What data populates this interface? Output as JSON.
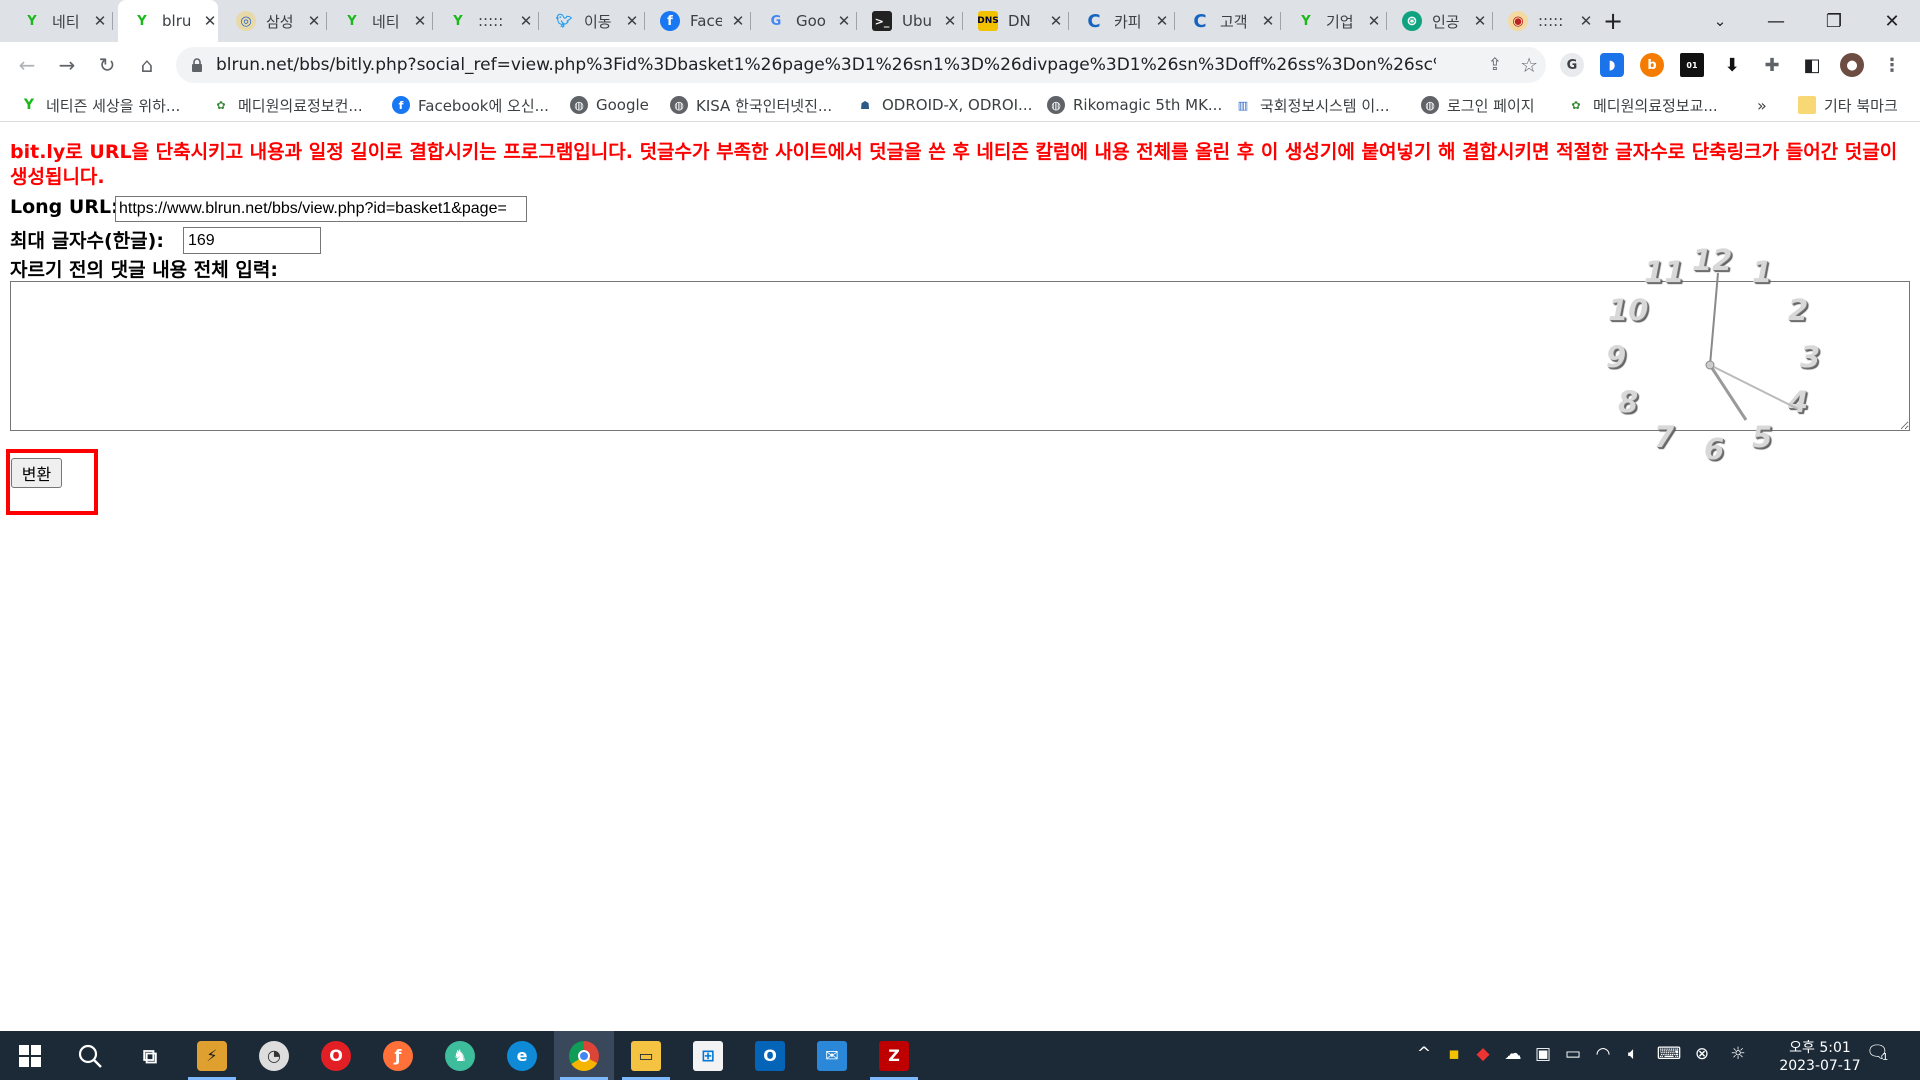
{
  "tabs": [
    {
      "label": "네티",
      "icon": "naver-sprout-icon"
    },
    {
      "label": "blru",
      "icon": "naver-sprout-icon",
      "active": true
    },
    {
      "label": "삼성",
      "icon": "site-globe-icon"
    },
    {
      "label": "네티",
      "icon": "naver-sprout-icon"
    },
    {
      "label": ":::::",
      "icon": "naver-sprout-icon"
    },
    {
      "label": "이동",
      "icon": "twitter-bird-icon"
    },
    {
      "label": "Face",
      "icon": "facebook-icon"
    },
    {
      "label": "Goo",
      "icon": "google-g-icon"
    },
    {
      "label": "Ubu",
      "icon": "terminal-icon"
    },
    {
      "label": "DN",
      "icon": "dns-icon"
    },
    {
      "label": "카피",
      "icon": "c-logo-icon"
    },
    {
      "label": "고객",
      "icon": "c-logo-icon"
    },
    {
      "label": "기업",
      "icon": "naver-sprout-icon"
    },
    {
      "label": "인공",
      "icon": "openai-icon"
    },
    {
      "label": ":::::",
      "icon": "site-emblem-icon"
    }
  ],
  "address_bar": {
    "url": "blrun.net/bbs/bitly.php?social_ref=view.php%3Fid%3Dbasket1%26page%3D1%26sn1%3D%26divpage%3D1%26sn%3Doff%26ss%3Don%26sc%3Don%26s..."
  },
  "bookmarks": [
    {
      "label": "네티즌 세상을 위하...",
      "icon": "naver-sprout-icon"
    },
    {
      "label": "메디원의료정보컨...",
      "icon": "medione-icon"
    },
    {
      "label": "Facebook에 오신...",
      "icon": "facebook-icon"
    },
    {
      "label": "Google",
      "icon": "globe-icon"
    },
    {
      "label": "KISA 한국인터넷진...",
      "icon": "globe-icon"
    },
    {
      "label": "ODROID-X, ODROI...",
      "icon": "odroid-icon"
    },
    {
      "label": "Rikomagic 5th MK...",
      "icon": "globe-icon"
    },
    {
      "label": "국회정보시스템 이...",
      "icon": "assembly-icon"
    },
    {
      "label": "로그인 페이지",
      "icon": "globe-icon"
    },
    {
      "label": "메디원의료정보교...",
      "icon": "medione-icon"
    }
  ],
  "bookmarks_overflow": "»",
  "other_bookmarks": "기타 북마크",
  "page": {
    "intro": "bit.ly로 URL을 단축시키고 내용과 일정 길이로 결합시키는 프로그램입니다. 덧글수가 부족한 사이트에서 덧글을 쓴 후 네티즌 칼럼에 내용 전체를 올린 후 이 생성기에 붙여넣기 해 결합시키면 적절한 글자수로 단축링크가 들어간 덧글이 생성됩니다.",
    "long_url_label": "Long URL:",
    "long_url_value": "https://www.blrun.net/bbs/view.php?id=basket1&page=",
    "max_chars_label": "최대 글자수(한글):",
    "max_chars_value": "169",
    "content_label": "자르기 전의 댓글 내용 전체 입력:",
    "content_value": "",
    "convert_button": "변환"
  },
  "analog_clock": {
    "numbers": [
      "12",
      "1",
      "2",
      "3",
      "4",
      "5",
      "6",
      "7",
      "8",
      "9",
      "10",
      "11"
    ],
    "time_shown": "5:01"
  },
  "taskbar": {
    "apps": [
      "start-icon",
      "search-icon",
      "task-view-icon",
      "sticky-app-icon",
      "clock-app-icon",
      "opera-icon",
      "firefox-icon",
      "cyberduck-icon",
      "edge-icon",
      "chrome-icon",
      "file-explorer-icon",
      "microsoft-store-icon",
      "outlook-icon",
      "mail-icon",
      "filezilla-icon"
    ],
    "active_app": "chrome-icon",
    "clock_ampm_time": "오후 5:01",
    "clock_date": "2023-07-17",
    "notification_count": "1"
  },
  "colors": {
    "intro_text": "#ff0000",
    "highlight_box": "#ff0000",
    "taskbar_bg": "#1c2a38",
    "tab_strip_bg": "#dee1e6"
  }
}
